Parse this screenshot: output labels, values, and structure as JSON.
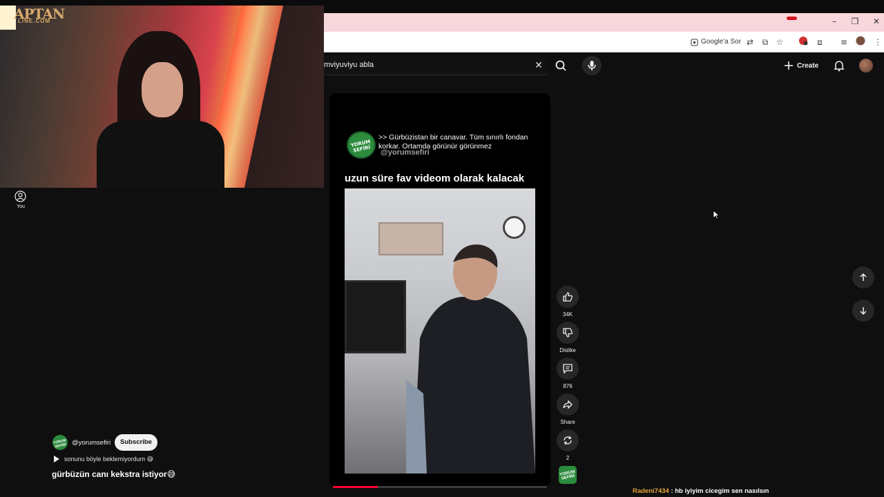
{
  "browser": {
    "google_ask_label": "Google'a Sor",
    "window_controls": [
      "–",
      "❐",
      "✕"
    ]
  },
  "youtube": {
    "search_value": "mviyuviyu abla",
    "create_label": "Create",
    "icons": [
      "search-icon",
      "mic-icon",
      "bell-icon",
      "close-icon",
      "plus-icon"
    ]
  },
  "short": {
    "quote_text": ">> Gürbüzistan bir canavar. Tüm sınırlı fondan korkar. Ortamda görünür görünmez",
    "quote_handle": "@yorumsefiri",
    "caption": "uzun süre fav videom olarak kalacak",
    "logo_text": "YORUM SEFİRİ",
    "progress": 0.21,
    "actions": {
      "like_count": "34K",
      "dislike_label": "Dislike",
      "comment_count": "876",
      "share_label": "Share",
      "remix_count": "2"
    }
  },
  "left_panel": {
    "you_label": "You",
    "channel_handle": "@yorumsefiri",
    "subscribe_label": "Subscribe",
    "sub_caption": "sonunu böyle beklemiyordum 😅",
    "main_caption": "gürbüzün canı kekstra istiyor😅"
  },
  "webcam": {
    "brand": "APTAN",
    "brand_sub": "LINE.COM"
  },
  "chat": {
    "user": "Radeni7434",
    "message": " : hb iyiyim cicegim sen nasılsın"
  },
  "colors": {
    "accent_red": "#ff0033",
    "bg": "#0f0f0f",
    "button_bg": "#272727",
    "chat_user": "#e6a23c"
  }
}
